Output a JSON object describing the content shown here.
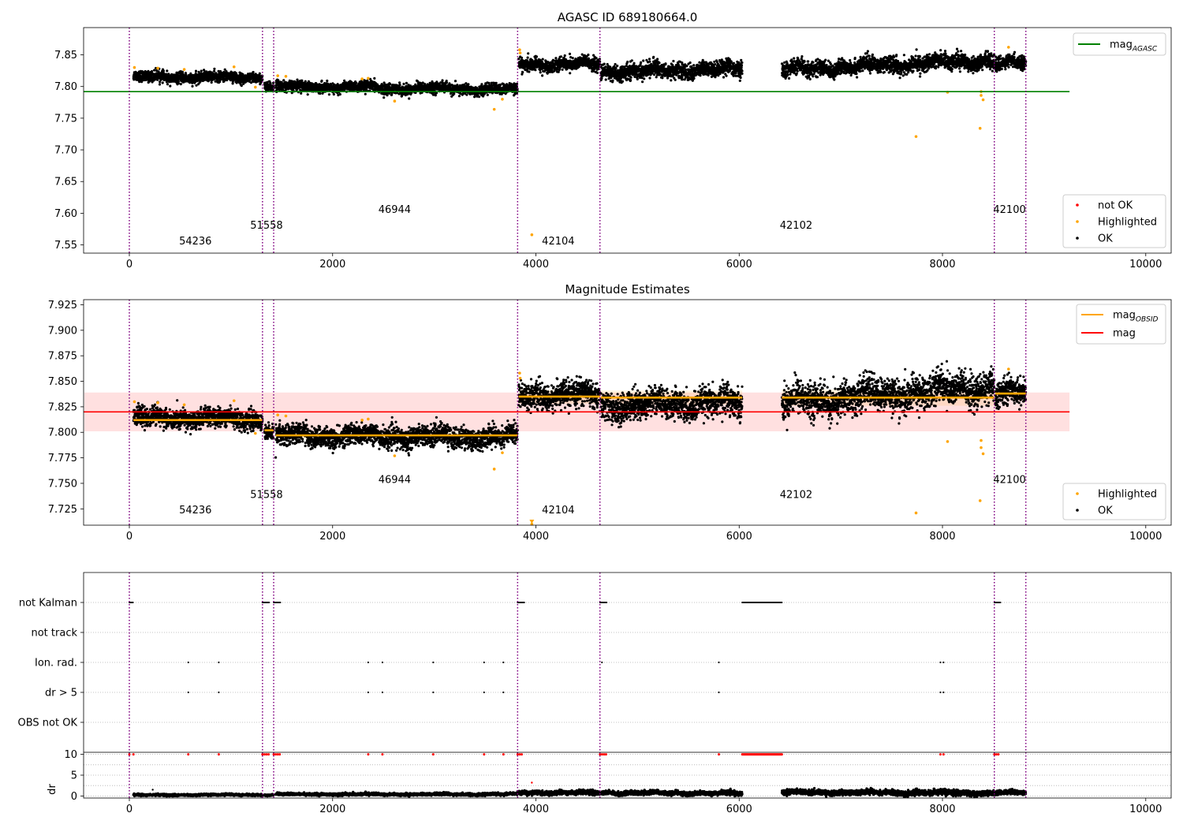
{
  "figure": {
    "background": "#ffffff"
  },
  "chart_data": [
    {
      "type": "scatter",
      "panel": "top",
      "title": "AGASC ID 689180664.0",
      "xlabel": "",
      "ylabel": "",
      "xlim": [
        -450,
        10250
      ],
      "ylim": [
        7.537,
        7.893
      ],
      "x_ticks": [
        0,
        2000,
        4000,
        6000,
        8000,
        10000
      ],
      "x_tick_labels": [
        "0",
        "2000",
        "4000",
        "6000",
        "8000",
        "10000"
      ],
      "y_ticks": [
        7.55,
        7.6,
        7.65,
        7.7,
        7.75,
        7.8,
        7.85
      ],
      "y_tick_labels": [
        "7.55",
        "7.60",
        "7.65",
        "7.70",
        "7.75",
        "7.80",
        "7.85"
      ],
      "grid": false,
      "legends": [
        {
          "placement": "top-right",
          "entries": [
            {
              "label": "mag",
              "subscript": "AGASC",
              "color": "#008000",
              "marker": "line"
            }
          ]
        },
        {
          "placement": "bottom-right",
          "entries": [
            {
              "label": "not OK",
              "color": "#ff0000",
              "marker": "dot"
            },
            {
              "label": "Highlighted",
              "color": "#ffa500",
              "marker": "dot"
            },
            {
              "label": "OK",
              "color": "#000000",
              "marker": "dot"
            }
          ]
        }
      ],
      "reference_lines": [
        {
          "name": "mag_AGASC",
          "y": 7.792,
          "x_range": [
            -450,
            9250
          ],
          "color": "#008000"
        }
      ],
      "obs_boundaries": [
        0,
        1310,
        1420,
        3820,
        4630,
        8510,
        8820
      ],
      "obs_labels": [
        {
          "text": "54236",
          "x": 650,
          "y": 7.5505
        },
        {
          "text": "51558",
          "x": 1350,
          "y": 7.5755
        },
        {
          "text": "46944",
          "x": 2610,
          "y": 7.6005
        },
        {
          "text": "42104",
          "x": 4220,
          "y": 7.5505
        },
        {
          "text": "42102",
          "x": 6560,
          "y": 7.5755
        },
        {
          "text": "42100",
          "x": 8660,
          "y": 7.6005
        }
      ],
      "segments": [
        {
          "x": [
            40,
            1310
          ],
          "y": [
            7.815,
            7.814
          ],
          "spread": 0.004
        },
        {
          "x": [
            1330,
            1420
          ],
          "y": [
            7.803,
            7.798
          ],
          "spread": 0.004
        },
        {
          "x": [
            1440,
            3820
          ],
          "y": [
            7.8,
            7.795
          ],
          "spread": 0.004
        },
        {
          "x": [
            3830,
            4630
          ],
          "y": [
            7.835,
            7.835
          ],
          "spread": 0.005
        },
        {
          "x": [
            4640,
            6030
          ],
          "y": [
            7.823,
            7.828
          ],
          "spread": 0.006
        },
        {
          "x": [
            6420,
            8510
          ],
          "y": [
            7.826,
            7.842
          ],
          "spread": 0.006
        },
        {
          "x": [
            8520,
            8820
          ],
          "y": [
            7.835,
            7.838
          ],
          "spread": 0.005
        }
      ],
      "highlighted_points": [
        [
          50,
          7.83
        ],
        [
          280,
          7.829
        ],
        [
          540,
          7.827
        ],
        [
          1030,
          7.831
        ],
        [
          1240,
          7.799
        ],
        [
          1460,
          7.817
        ],
        [
          1540,
          7.816
        ],
        [
          2290,
          7.812
        ],
        [
          2350,
          7.813
        ],
        [
          2610,
          7.777
        ],
        [
          3590,
          7.764
        ],
        [
          3670,
          7.78
        ],
        [
          3840,
          7.858
        ],
        [
          3845,
          7.853
        ],
        [
          3960,
          7.566
        ],
        [
          7740,
          7.721
        ],
        [
          8050,
          7.791
        ],
        [
          8370,
          7.734
        ],
        [
          8380,
          7.786
        ],
        [
          8380,
          7.792
        ],
        [
          8400,
          7.779
        ],
        [
          8650,
          7.862
        ]
      ]
    },
    {
      "type": "scatter",
      "panel": "middle",
      "title": "Magnitude Estimates",
      "xlabel": "",
      "ylabel": "",
      "xlim": [
        -450,
        10250
      ],
      "ylim": [
        7.709,
        7.93
      ],
      "x_ticks": [
        0,
        2000,
        4000,
        6000,
        8000,
        10000
      ],
      "x_tick_labels": [
        "0",
        "2000",
        "4000",
        "6000",
        "8000",
        "10000"
      ],
      "y_ticks": [
        7.725,
        7.75,
        7.775,
        7.8,
        7.825,
        7.85,
        7.875,
        7.9,
        7.925
      ],
      "y_tick_labels": [
        "7.725",
        "7.750",
        "7.775",
        "7.800",
        "7.825",
        "7.850",
        "7.875",
        "7.900",
        "7.925"
      ],
      "grid": false,
      "legends": [
        {
          "placement": "top-right",
          "entries": [
            {
              "label": "mag",
              "subscript": "OBSID",
              "color": "#ffa500",
              "marker": "line"
            },
            {
              "label": "mag",
              "subscript": "",
              "color": "#ff0000",
              "marker": "line"
            }
          ]
        },
        {
          "placement": "bottom-right",
          "entries": [
            {
              "label": "Highlighted",
              "color": "#ffa500",
              "marker": "dot"
            },
            {
              "label": "OK",
              "color": "#000000",
              "marker": "dot"
            }
          ]
        }
      ],
      "reference_lines": [
        {
          "name": "mag",
          "y": 7.82,
          "x_range": [
            -450,
            9250
          ],
          "color": "#ff0000"
        }
      ],
      "reference_band": {
        "y": [
          7.801,
          7.839
        ],
        "x_range": [
          -450,
          9250
        ],
        "color": "#ff0000",
        "opacity": 0.12
      },
      "obsid_mag": [
        {
          "x": [
            40,
            1310
          ],
          "y": 7.812,
          "err": 0.004
        },
        {
          "x": [
            1330,
            1420
          ],
          "y": 7.802,
          "err": 0.004
        },
        {
          "x": [
            1440,
            3820
          ],
          "y": 7.797,
          "err": 0.004
        },
        {
          "x": [
            3830,
            4630
          ],
          "y": 7.835,
          "err": 0.007
        },
        {
          "x": [
            4640,
            6030
          ],
          "y": 7.834,
          "err": 0.007
        },
        {
          "x": [
            6420,
            8510
          ],
          "y": 7.834,
          "err": 0.008
        },
        {
          "x": [
            8520,
            8820
          ],
          "y": 7.838,
          "err": 0.004
        }
      ],
      "obs_boundaries": [
        0,
        1310,
        1420,
        3820,
        4630,
        8510,
        8820
      ],
      "obs_labels": [
        {
          "text": "54236",
          "x": 650,
          "y": 7.7205
        },
        {
          "text": "51558",
          "x": 1350,
          "y": 7.7355
        },
        {
          "text": "46944",
          "x": 2610,
          "y": 7.7505
        },
        {
          "text": "42104",
          "x": 4220,
          "y": 7.7205
        },
        {
          "text": "42102",
          "x": 6560,
          "y": 7.7355
        },
        {
          "text": "42100",
          "x": 8660,
          "y": 7.7505
        }
      ],
      "segments": [
        {
          "x": [
            40,
            1310
          ],
          "y": [
            7.814,
            7.813
          ],
          "spread": 0.0045
        },
        {
          "x": [
            1330,
            1420
          ],
          "y": [
            7.803,
            7.798
          ],
          "spread": 0.004
        },
        {
          "x": [
            1440,
            3820
          ],
          "y": [
            7.797,
            7.795
          ],
          "spread": 0.005
        },
        {
          "x": [
            3830,
            4630
          ],
          "y": [
            7.837,
            7.836
          ],
          "spread": 0.006
        },
        {
          "x": [
            4640,
            6030
          ],
          "y": [
            7.826,
            7.829
          ],
          "spread": 0.007
        },
        {
          "x": [
            6420,
            8510
          ],
          "y": [
            7.829,
            7.845
          ],
          "spread": 0.008
        },
        {
          "x": [
            8520,
            8820
          ],
          "y": [
            7.837,
            7.839
          ],
          "spread": 0.006
        }
      ],
      "highlighted_points": [
        [
          50,
          7.83
        ],
        [
          280,
          7.829
        ],
        [
          540,
          7.827
        ],
        [
          1030,
          7.831
        ],
        [
          1240,
          7.799
        ],
        [
          1460,
          7.817
        ],
        [
          1540,
          7.816
        ],
        [
          2290,
          7.812
        ],
        [
          2350,
          7.813
        ],
        [
          2610,
          7.777
        ],
        [
          3590,
          7.764
        ],
        [
          3670,
          7.78
        ],
        [
          3840,
          7.858
        ],
        [
          3845,
          7.853
        ],
        [
          3960,
          7.71
        ],
        [
          7740,
          7.721
        ],
        [
          8050,
          7.791
        ],
        [
          8370,
          7.733
        ],
        [
          8380,
          7.785
        ],
        [
          8380,
          7.792
        ],
        [
          8400,
          7.779
        ],
        [
          8650,
          7.862
        ]
      ]
    },
    {
      "type": "scatter",
      "panel": "bottom-flags",
      "title": "",
      "xlim": [
        -450,
        10250
      ],
      "categories": [
        "not Kalman",
        "not track",
        "Ion. rad.",
        "dr > 5",
        "OBS not OK"
      ],
      "grid": true,
      "obs_boundaries": [
        0,
        1310,
        1420,
        3820,
        4630,
        8510,
        8820
      ],
      "flags": [
        {
          "category": "not Kalman",
          "ranges": [
            [
              0,
              40
            ],
            [
              1310,
              1380
            ],
            [
              1420,
              1490
            ],
            [
              3820,
              3890
            ],
            [
              4630,
              4700
            ],
            [
              6030,
              6420
            ],
            [
              8510,
              8570
            ]
          ]
        },
        {
          "category": "not track",
          "ranges": []
        },
        {
          "category": "Ion. rad.",
          "x": [
            580,
            880,
            2350,
            2490,
            2990,
            3490,
            3680,
            4650,
            5800,
            7980,
            8010
          ]
        },
        {
          "category": "dr > 5",
          "x": [
            580,
            880,
            2350,
            2490,
            2990,
            3490,
            3680,
            5800,
            7980,
            8010
          ]
        },
        {
          "category": "OBS not OK",
          "x": []
        }
      ]
    },
    {
      "type": "scatter",
      "panel": "bottom-dr",
      "title": "",
      "xlabel": "",
      "ylabel": "dr",
      "xlim": [
        -450,
        10250
      ],
      "ylim": [
        -0.5,
        10.5
      ],
      "x_ticks": [
        0,
        2000,
        4000,
        6000,
        8000,
        10000
      ],
      "x_tick_labels": [
        "0",
        "2000",
        "4000",
        "6000",
        "8000",
        "10000"
      ],
      "y_ticks": [
        0,
        5,
        10
      ],
      "y_tick_labels": [
        "0",
        "5",
        "10"
      ],
      "grid": true,
      "obs_boundaries": [
        0,
        1310,
        1420,
        3820,
        4630,
        8510,
        8820
      ],
      "clipped_value": 10,
      "clipped_x": [
        0,
        40,
        1310,
        1330,
        1350,
        1370,
        1420,
        1440,
        1460,
        1480,
        580,
        880,
        2350,
        2490,
        2990,
        3490,
        3680,
        3820,
        3840,
        3860,
        4630,
        4650,
        4670,
        4690,
        5800,
        7980,
        8010,
        8510,
        8530,
        8550
      ],
      "clipped_range": [
        6030,
        6420
      ],
      "segments": [
        {
          "x": [
            40,
            1310
          ],
          "y": [
            0.2,
            0.3
          ],
          "spread": 0.12
        },
        {
          "x": [
            1330,
            1420
          ],
          "y": [
            0.2,
            0.2
          ],
          "spread": 0.1
        },
        {
          "x": [
            1440,
            3820
          ],
          "y": [
            0.4,
            0.4
          ],
          "spread": 0.15
        },
        {
          "x": [
            3830,
            4630
          ],
          "y": [
            0.8,
            0.8
          ],
          "spread": 0.25
        },
        {
          "x": [
            4640,
            6030
          ],
          "y": [
            0.8,
            0.6
          ],
          "spread": 0.25
        },
        {
          "x": [
            6420,
            8510
          ],
          "y": [
            0.9,
            0.7
          ],
          "spread": 0.3
        },
        {
          "x": [
            8520,
            8820
          ],
          "y": [
            0.8,
            0.8
          ],
          "spread": 0.25
        }
      ],
      "extra_points": [
        [
          230,
          1.5
        ],
        [
          3960,
          3.2
        ]
      ]
    }
  ]
}
